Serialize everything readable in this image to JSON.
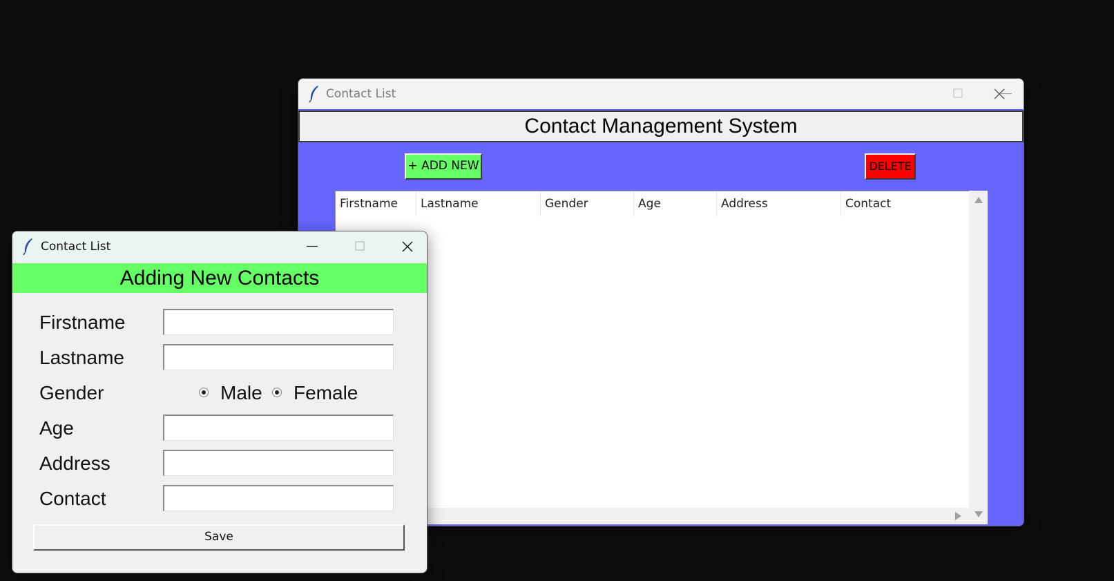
{
  "main_window": {
    "title": "Contact List",
    "header": "Contact Management System",
    "add_button": "+ ADD NEW",
    "delete_button": "DELETE",
    "columns": [
      "Firstname",
      "Lastname",
      "Gender",
      "Age",
      "Address",
      "Contact"
    ],
    "rows": []
  },
  "add_window": {
    "title": "Contact List",
    "header": "Adding New Contacts",
    "fields": {
      "firstname": {
        "label": "Firstname",
        "value": ""
      },
      "lastname": {
        "label": "Lastname",
        "value": ""
      },
      "gender": {
        "label": "Gender",
        "options": [
          "Male",
          "Female"
        ]
      },
      "age": {
        "label": "Age",
        "value": ""
      },
      "address": {
        "label": "Address",
        "value": ""
      },
      "contact": {
        "label": "Contact",
        "value": ""
      }
    },
    "save_button": "Save"
  },
  "colors": {
    "main_background": "#6666ff",
    "add_header_background": "#66ff66",
    "add_button_background": "#66ff66",
    "delete_button_background": "#ff0000",
    "desktop_background": "#0d0d0d"
  },
  "icons": {
    "app_icon": "feather-icon",
    "minimize": "minimize-icon",
    "maximize": "maximize-icon",
    "close": "close-icon"
  }
}
